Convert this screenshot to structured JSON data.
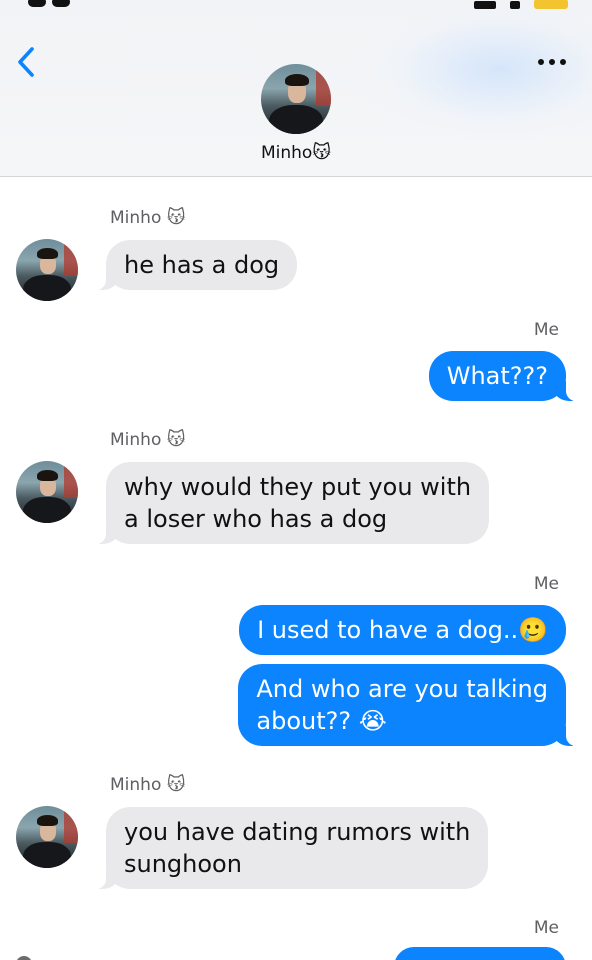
{
  "header": {
    "contact_name": "Minho",
    "contact_emoji": "😽",
    "back_icon": "chevron-left-icon",
    "more_icon": "ellipsis-icon",
    "accent_color": "#0b84fe"
  },
  "messages": [
    {
      "sender": "Minho",
      "sender_emoji": "😽",
      "text": "he has a dog"
    },
    {
      "sender": "Me",
      "text": "What???"
    },
    {
      "sender": "Minho",
      "sender_emoji": "😽",
      "line1": "why would they put you with",
      "line2": "a loser who has a dog"
    },
    {
      "sender": "Me",
      "text": "I used to have a dog..🥲"
    },
    {
      "sender": "Me",
      "line1": "And who are you talking",
      "line2": "about?? 😭"
    },
    {
      "sender": "Minho",
      "sender_emoji": "😽",
      "line1": "you have dating rumors with",
      "line2": "sunghoon"
    },
    {
      "sender": "Me"
    }
  ],
  "colors": {
    "incoming_bubble": "#e9e9eb",
    "outgoing_bubble": "#0b84fe",
    "label_gray": "#5f5f63"
  }
}
